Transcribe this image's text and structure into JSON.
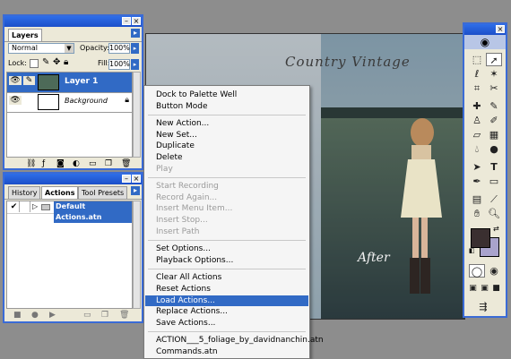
{
  "layers_panel": {
    "tab": "Layers",
    "blend_mode": "Normal",
    "opacity_label": "Opacity:",
    "opacity": "100%",
    "lock_label": "Lock:",
    "fill_label": "Fill:",
    "fill": "100%",
    "layers": [
      {
        "name": "Layer 1",
        "selected": true
      },
      {
        "name": "Background",
        "selected": false
      }
    ]
  },
  "actions_panel": {
    "tabs": [
      "History",
      "Actions",
      "Tool Presets"
    ],
    "active_tab": "Actions",
    "set_name": "Default Actions.atn"
  },
  "canvas": {
    "title_text": "Country Vintage",
    "after_text": "After"
  },
  "context_menu": {
    "items": [
      {
        "label": "Dock to Palette Well",
        "state": "enabled"
      },
      {
        "label": "Button Mode",
        "state": "enabled"
      },
      {
        "label": "New Action...",
        "state": "enabled"
      },
      {
        "label": "New Set...",
        "state": "enabled"
      },
      {
        "label": "Duplicate",
        "state": "enabled"
      },
      {
        "label": "Delete",
        "state": "enabled"
      },
      {
        "label": "Play",
        "state": "disabled"
      },
      {
        "label": "Start Recording",
        "state": "disabled"
      },
      {
        "label": "Record Again...",
        "state": "disabled"
      },
      {
        "label": "Insert Menu Item...",
        "state": "disabled"
      },
      {
        "label": "Insert Stop...",
        "state": "disabled"
      },
      {
        "label": "Insert Path",
        "state": "disabled"
      },
      {
        "label": "Set Options...",
        "state": "enabled"
      },
      {
        "label": "Playback Options...",
        "state": "enabled"
      },
      {
        "label": "Clear All Actions",
        "state": "enabled"
      },
      {
        "label": "Reset Actions",
        "state": "enabled"
      },
      {
        "label": "Load Actions...",
        "state": "highlighted"
      },
      {
        "label": "Replace Actions...",
        "state": "enabled"
      },
      {
        "label": "Save Actions...",
        "state": "enabled"
      },
      {
        "label": "ACTION___5_foliage_by_davidnanchin.atn",
        "state": "enabled"
      },
      {
        "label": "Commands.atn",
        "state": "enabled"
      }
    ]
  },
  "colors": {
    "panel_bg": "#ece9d8",
    "titlebar": "#1c4fc9",
    "selection": "#316ac5",
    "foreground_swatch": "#3a2f30",
    "background_swatch": "#a9a3cc"
  }
}
